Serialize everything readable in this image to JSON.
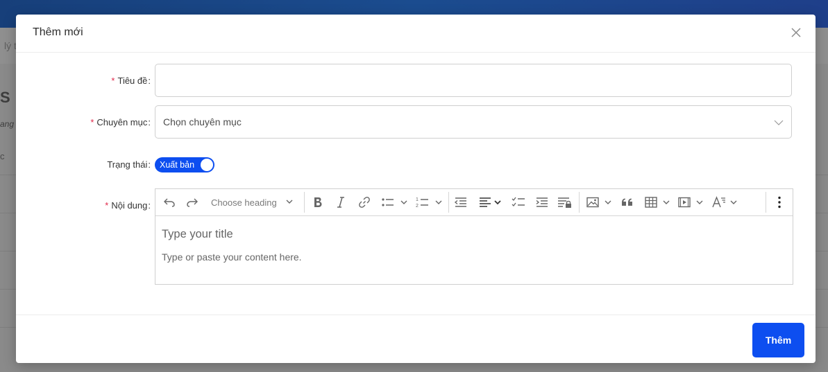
{
  "background": {
    "search_text": "lý t",
    "heading_text": "S",
    "sub_text": "ang",
    "column_text": "c"
  },
  "modal": {
    "title": "Thêm mới",
    "fields": {
      "title_label": "Tiêu đề",
      "title_value": "",
      "category_label": "Chuyên mục",
      "category_placeholder": "Chọn chuyên mục",
      "status_label": "Trạng thái",
      "status_value": "Xuất bản",
      "status_on": true,
      "content_label": "Nội dung"
    },
    "editor": {
      "heading_select": "Choose heading",
      "title_placeholder": "Type your title",
      "body_placeholder": "Type or paste your content here."
    },
    "submit_label": "Thêm"
  },
  "colors": {
    "primary": "#0d4ef0",
    "required": "#e0284a"
  }
}
